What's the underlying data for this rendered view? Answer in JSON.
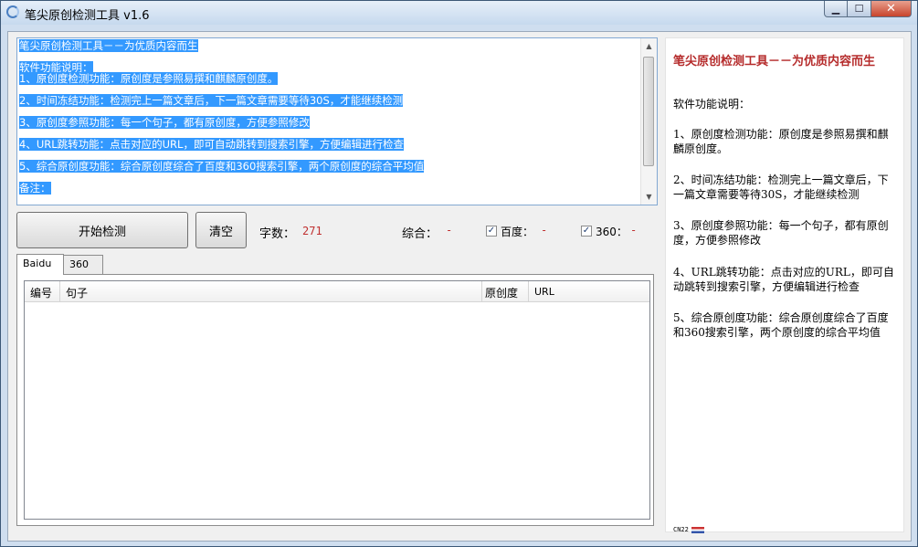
{
  "window": {
    "title": "笔尖原创检测工具 v1.6"
  },
  "input_text": {
    "lines": [
      "笔尖原创检测工具－－为优质内容而生",
      "",
      "软件功能说明：",
      "1、原创度检测功能：原创度是参照易撰和麒麟原创度。",
      "",
      "2、时间冻结功能：检测完上一篇文章后，下一篇文章需要等待30S，才能继续检测",
      "",
      "3、原创度参照功能：每一个句子，都有原创度，方便参照修改",
      "",
      "4、URL跳转功能：点击对应的URL，即可自动跳转到搜索引擎，方便编辑进行检查",
      "",
      "5、综合原创度功能：综合原创度综合了百度和360搜索引擎，两个原创度的综合平均值",
      "",
      "备注："
    ]
  },
  "buttons": {
    "start": "开始检测",
    "clear": "清空"
  },
  "stats": {
    "char_count_label": "字数：",
    "char_count_value": "271",
    "overall_label": "综合：",
    "overall_value": "-",
    "baidu_label": "百度：",
    "baidu_value": "-",
    "baidu_checked": true,
    "s360_label": "360：",
    "s360_value": "-",
    "s360_checked": true
  },
  "tabs": [
    "Baidu",
    "360"
  ],
  "table": {
    "columns": [
      "编号",
      "句子",
      "原创度",
      "URL"
    ]
  },
  "help_panel": {
    "title": "笔尖原创检测工具－－为优质内容而生",
    "heading": "软件功能说明：",
    "items": [
      "1、原创度检测功能：原创度是参照易撰和麒麟原创度。",
      "2、时间冻结功能：检测完上一篇文章后，下一篇文章需要等待30S，才能继续检测",
      "3、原创度参照功能：每一个句子，都有原创度，方便参照修改",
      "4、URL跳转功能：点击对应的URL，即可自动跳转到搜索引擎，方便编辑进行检查",
      "5、综合原创度功能：综合原创度综合了百度和360搜索引擎，两个原创度的综合平均值"
    ]
  },
  "ime": {
    "label": "CN22"
  },
  "colors": {
    "selection": "#3399ff",
    "accent_red": "#c03030",
    "title_red": "#b52b2b"
  }
}
